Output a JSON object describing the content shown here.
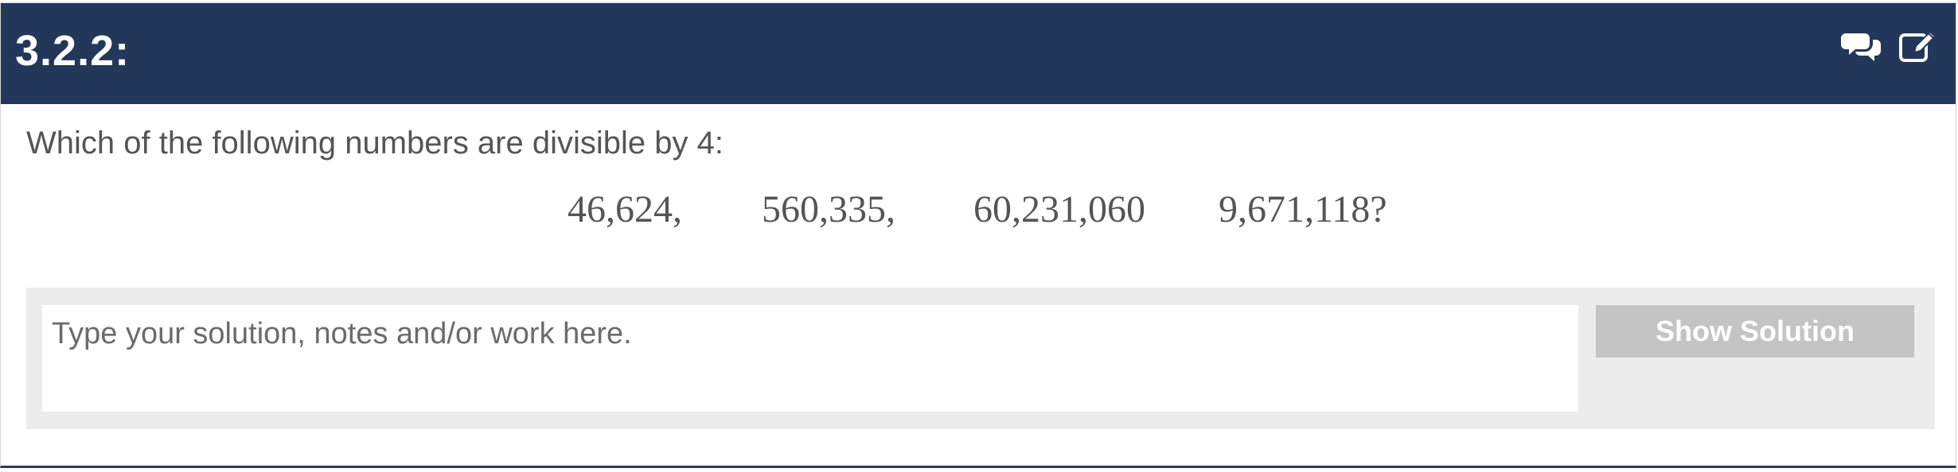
{
  "header": {
    "title": "3.2.2:",
    "background_color": "#22375a",
    "icons": [
      "comments-icon",
      "edit-icon"
    ]
  },
  "question": {
    "text": "Which of the following numbers are divisible by 4:",
    "numbers": [
      "46,624,",
      "560,335,",
      "60,231,060",
      "9,671,118?"
    ]
  },
  "solution": {
    "placeholder": "Type your solution, notes and/or work here.",
    "value": "",
    "show_solution_label": "Show Solution",
    "button_color": "#c4c4c4",
    "panel_color": "#ececec"
  }
}
